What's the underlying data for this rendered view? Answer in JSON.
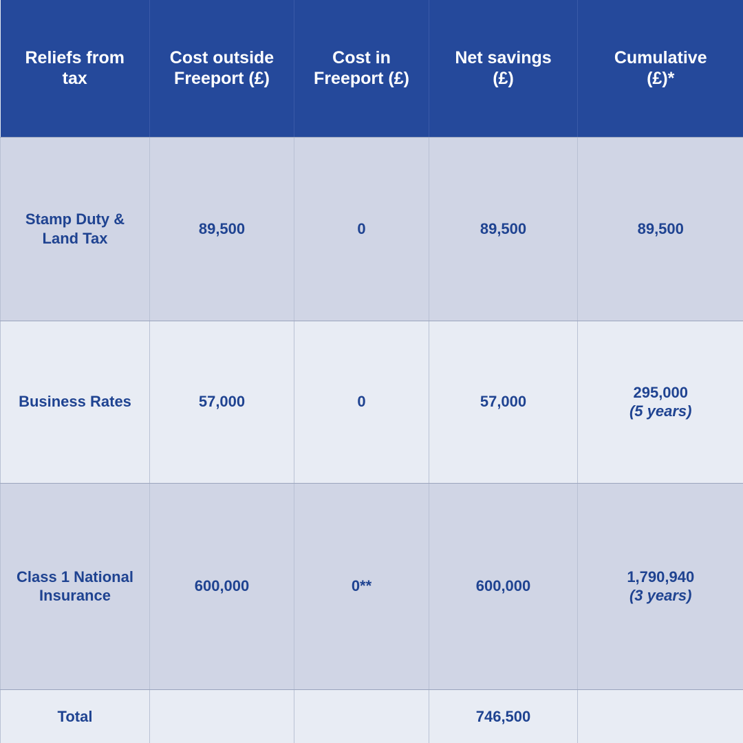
{
  "table": {
    "columns": [
      {
        "id": "relief",
        "label": "Reliefs from\ntax"
      },
      {
        "id": "outside",
        "label": "Cost outside\nFreeport (£)"
      },
      {
        "id": "inside",
        "label": "Cost in\nFreeport (£)"
      },
      {
        "id": "net",
        "label": "Net savings\n(£)"
      },
      {
        "id": "cumul",
        "label": "Cumulative\n(£)*"
      }
    ],
    "header": {
      "col1_line1": "Reliefs from",
      "col1_line2": "tax",
      "col2_line1": "Cost outside",
      "col2_line2": "Freeport (£)",
      "col3_line1": "Cost in",
      "col3_line2": "Freeport (£)",
      "col4_line1": "Net savings",
      "col4_line2": "(£)",
      "col5_line1": "Cumulative",
      "col5_line2": "(£)*"
    },
    "rows": [
      {
        "relief_line1": "Stamp Duty &",
        "relief_line2": "Land Tax",
        "outside": "89,500",
        "inside": "0",
        "net": "89,500",
        "cumulative": "89,500",
        "cumulative_note": ""
      },
      {
        "relief_line1": "Business Rates",
        "relief_line2": "",
        "outside": "57,000",
        "inside": "0",
        "net": "57,000",
        "cumulative": "295,000",
        "cumulative_note": "(5 years)"
      },
      {
        "relief_line1": "Class 1 National",
        "relief_line2": "Insurance",
        "outside": "600,000",
        "inside": "0**",
        "net": "600,000",
        "cumulative": "1,790,940",
        "cumulative_note": "(3 years)"
      }
    ],
    "total_row": {
      "label": "Total",
      "outside": "",
      "inside": "",
      "net": "746,500",
      "cumulative": ""
    }
  },
  "colors": {
    "header_bg": "#25499b",
    "header_text": "#ffffff",
    "row_dark_bg": "#d0d5e5",
    "row_light_bg": "#e8ecf4",
    "body_text": "#1f4391",
    "grid_line": "#b9c1d4"
  }
}
